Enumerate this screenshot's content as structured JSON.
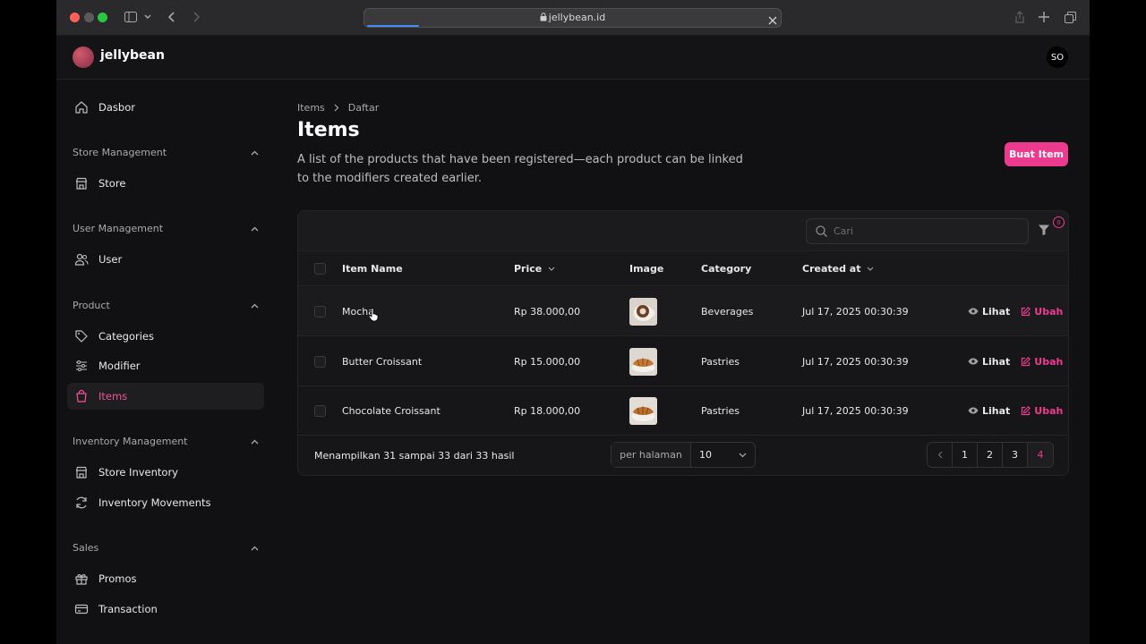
{
  "browser": {
    "url": "jellybean.id"
  },
  "app": {
    "brand": "jellybean",
    "avatar_initials": "SO"
  },
  "sidebar": {
    "dashboard": "Dasbor",
    "groups": [
      {
        "title": "Store Management",
        "items": [
          "Store"
        ]
      },
      {
        "title": "User Management",
        "items": [
          "User"
        ]
      },
      {
        "title": "Product",
        "items": [
          "Categories",
          "Modifier",
          "Items"
        ]
      },
      {
        "title": "Inventory Management",
        "items": [
          "Store Inventory",
          "Inventory Movements"
        ]
      },
      {
        "title": "Sales",
        "items": [
          "Promos",
          "Transaction"
        ]
      }
    ],
    "active_item": "Items"
  },
  "page": {
    "breadcrumb": [
      "Items",
      "Daftar"
    ],
    "title": "Items",
    "description": "A list of the products that have been registered—each product can be linked to the modifiers created earlier.",
    "create_button": "Buat Item"
  },
  "table": {
    "search_placeholder": "Cari",
    "filter_count": "0",
    "columns": [
      "Item Name",
      "Price",
      "Image",
      "Category",
      "Created at"
    ],
    "rows": [
      {
        "name": "Mocha",
        "price": "Rp 38.000,00",
        "image": "mocha-photo",
        "category": "Beverages",
        "created_at": "Jul 17, 2025 00:30:39"
      },
      {
        "name": "Butter Croissant",
        "price": "Rp 15.000,00",
        "image": "croissant-photo",
        "category": "Pastries",
        "created_at": "Jul 17, 2025 00:30:39"
      },
      {
        "name": "Chocolate Croissant",
        "price": "Rp 18.000,00",
        "image": "croissant-photo",
        "category": "Pastries",
        "created_at": "Jul 17, 2025 00:30:39"
      }
    ],
    "actions": {
      "view": "Lihat",
      "edit": "Ubah"
    },
    "footer": {
      "summary": "Menampilkan 31 sampai 33 dari 33 hasil",
      "per_page_label": "per halaman",
      "per_page_value": "10",
      "pages": [
        "1",
        "2",
        "3",
        "4"
      ],
      "current_page": "4"
    }
  },
  "colors": {
    "accent": "#ec3b8f",
    "background": "#111113"
  }
}
